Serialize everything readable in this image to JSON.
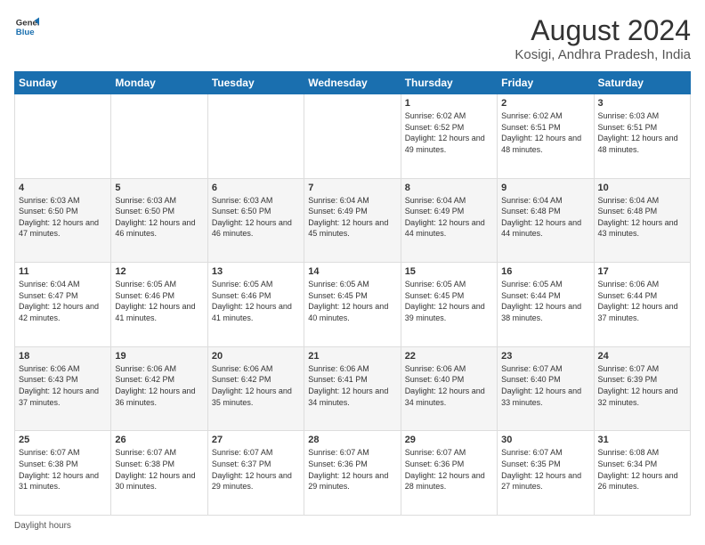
{
  "header": {
    "logo_line1": "General",
    "logo_line2": "Blue",
    "main_title": "August 2024",
    "subtitle": "Kosigi, Andhra Pradesh, India"
  },
  "weekdays": [
    "Sunday",
    "Monday",
    "Tuesday",
    "Wednesday",
    "Thursday",
    "Friday",
    "Saturday"
  ],
  "weeks": [
    [
      {
        "day": "",
        "info": ""
      },
      {
        "day": "",
        "info": ""
      },
      {
        "day": "",
        "info": ""
      },
      {
        "day": "",
        "info": ""
      },
      {
        "day": "1",
        "info": "Sunrise: 6:02 AM\nSunset: 6:52 PM\nDaylight: 12 hours and 49 minutes."
      },
      {
        "day": "2",
        "info": "Sunrise: 6:02 AM\nSunset: 6:51 PM\nDaylight: 12 hours and 48 minutes."
      },
      {
        "day": "3",
        "info": "Sunrise: 6:03 AM\nSunset: 6:51 PM\nDaylight: 12 hours and 48 minutes."
      }
    ],
    [
      {
        "day": "4",
        "info": "Sunrise: 6:03 AM\nSunset: 6:50 PM\nDaylight: 12 hours and 47 minutes."
      },
      {
        "day": "5",
        "info": "Sunrise: 6:03 AM\nSunset: 6:50 PM\nDaylight: 12 hours and 46 minutes."
      },
      {
        "day": "6",
        "info": "Sunrise: 6:03 AM\nSunset: 6:50 PM\nDaylight: 12 hours and 46 minutes."
      },
      {
        "day": "7",
        "info": "Sunrise: 6:04 AM\nSunset: 6:49 PM\nDaylight: 12 hours and 45 minutes."
      },
      {
        "day": "8",
        "info": "Sunrise: 6:04 AM\nSunset: 6:49 PM\nDaylight: 12 hours and 44 minutes."
      },
      {
        "day": "9",
        "info": "Sunrise: 6:04 AM\nSunset: 6:48 PM\nDaylight: 12 hours and 44 minutes."
      },
      {
        "day": "10",
        "info": "Sunrise: 6:04 AM\nSunset: 6:48 PM\nDaylight: 12 hours and 43 minutes."
      }
    ],
    [
      {
        "day": "11",
        "info": "Sunrise: 6:04 AM\nSunset: 6:47 PM\nDaylight: 12 hours and 42 minutes."
      },
      {
        "day": "12",
        "info": "Sunrise: 6:05 AM\nSunset: 6:46 PM\nDaylight: 12 hours and 41 minutes."
      },
      {
        "day": "13",
        "info": "Sunrise: 6:05 AM\nSunset: 6:46 PM\nDaylight: 12 hours and 41 minutes."
      },
      {
        "day": "14",
        "info": "Sunrise: 6:05 AM\nSunset: 6:45 PM\nDaylight: 12 hours and 40 minutes."
      },
      {
        "day": "15",
        "info": "Sunrise: 6:05 AM\nSunset: 6:45 PM\nDaylight: 12 hours and 39 minutes."
      },
      {
        "day": "16",
        "info": "Sunrise: 6:05 AM\nSunset: 6:44 PM\nDaylight: 12 hours and 38 minutes."
      },
      {
        "day": "17",
        "info": "Sunrise: 6:06 AM\nSunset: 6:44 PM\nDaylight: 12 hours and 37 minutes."
      }
    ],
    [
      {
        "day": "18",
        "info": "Sunrise: 6:06 AM\nSunset: 6:43 PM\nDaylight: 12 hours and 37 minutes."
      },
      {
        "day": "19",
        "info": "Sunrise: 6:06 AM\nSunset: 6:42 PM\nDaylight: 12 hours and 36 minutes."
      },
      {
        "day": "20",
        "info": "Sunrise: 6:06 AM\nSunset: 6:42 PM\nDaylight: 12 hours and 35 minutes."
      },
      {
        "day": "21",
        "info": "Sunrise: 6:06 AM\nSunset: 6:41 PM\nDaylight: 12 hours and 34 minutes."
      },
      {
        "day": "22",
        "info": "Sunrise: 6:06 AM\nSunset: 6:40 PM\nDaylight: 12 hours and 34 minutes."
      },
      {
        "day": "23",
        "info": "Sunrise: 6:07 AM\nSunset: 6:40 PM\nDaylight: 12 hours and 33 minutes."
      },
      {
        "day": "24",
        "info": "Sunrise: 6:07 AM\nSunset: 6:39 PM\nDaylight: 12 hours and 32 minutes."
      }
    ],
    [
      {
        "day": "25",
        "info": "Sunrise: 6:07 AM\nSunset: 6:38 PM\nDaylight: 12 hours and 31 minutes."
      },
      {
        "day": "26",
        "info": "Sunrise: 6:07 AM\nSunset: 6:38 PM\nDaylight: 12 hours and 30 minutes."
      },
      {
        "day": "27",
        "info": "Sunrise: 6:07 AM\nSunset: 6:37 PM\nDaylight: 12 hours and 29 minutes."
      },
      {
        "day": "28",
        "info": "Sunrise: 6:07 AM\nSunset: 6:36 PM\nDaylight: 12 hours and 29 minutes."
      },
      {
        "day": "29",
        "info": "Sunrise: 6:07 AM\nSunset: 6:36 PM\nDaylight: 12 hours and 28 minutes."
      },
      {
        "day": "30",
        "info": "Sunrise: 6:07 AM\nSunset: 6:35 PM\nDaylight: 12 hours and 27 minutes."
      },
      {
        "day": "31",
        "info": "Sunrise: 6:08 AM\nSunset: 6:34 PM\nDaylight: 12 hours and 26 minutes."
      }
    ]
  ],
  "footer": {
    "daylight_label": "Daylight hours"
  }
}
